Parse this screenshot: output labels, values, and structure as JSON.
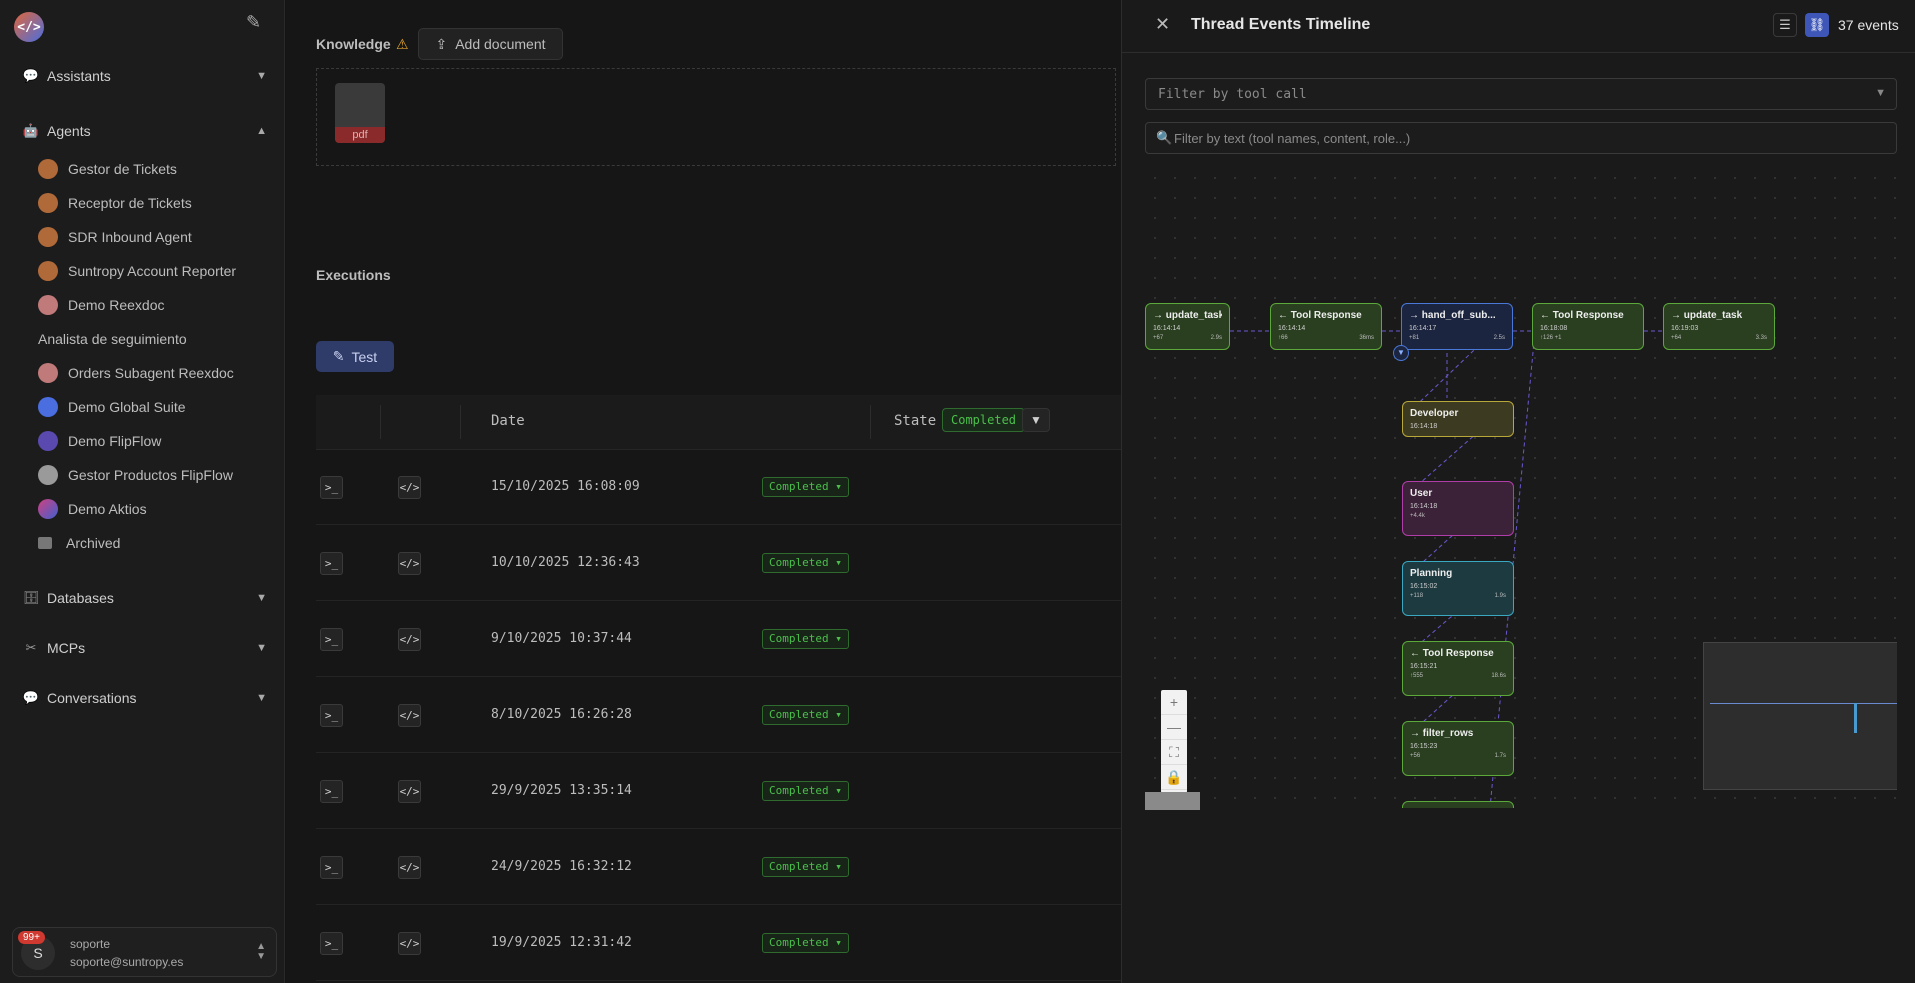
{
  "sidebar": {
    "logo_text": "</>",
    "sections": {
      "assistants": "Assistants",
      "agents": "Agents",
      "databases": "Databases",
      "mcps": "MCPs",
      "conversations": "Conversations"
    },
    "agents": [
      {
        "label": "Gestor de Tickets"
      },
      {
        "label": "Receptor de Tickets"
      },
      {
        "label": "SDR Inbound Agent"
      },
      {
        "label": "Suntropy Account Reporter"
      },
      {
        "label": "Demo Reexdoc"
      },
      {
        "label": "Analista de seguimiento"
      },
      {
        "label": "Orders Subagent Reexdoc"
      },
      {
        "label": "Demo Global Suite"
      },
      {
        "label": "Demo FlipFlow"
      },
      {
        "label": "Gestor Productos FlipFlow"
      },
      {
        "label": "Demo Aktios"
      },
      {
        "label": "Archived"
      }
    ],
    "user": {
      "badge": "99+",
      "initial": "S",
      "name": "soporte",
      "email": "soporte@suntropy.es"
    }
  },
  "main": {
    "knowledge_label": "Knowledge",
    "add_document_label": "Add document",
    "pdf_label": "pdf",
    "executions_label": "Executions",
    "test_label": "Test",
    "columns": {
      "date": "Date",
      "state": "State"
    },
    "state_filter": "Completed",
    "rows": [
      {
        "date": "15/10/2025 16:08:09",
        "status": "Completed"
      },
      {
        "date": "10/10/2025 12:36:43",
        "status": "Completed"
      },
      {
        "date": "9/10/2025 10:37:44",
        "status": "Completed"
      },
      {
        "date": "8/10/2025 16:26:28",
        "status": "Completed"
      },
      {
        "date": "29/9/2025 13:35:14",
        "status": "Completed"
      },
      {
        "date": "24/9/2025 16:32:12",
        "status": "Completed"
      },
      {
        "date": "19/9/2025 12:31:42",
        "status": "Completed"
      }
    ]
  },
  "panel": {
    "title": "Thread Events Timeline",
    "events_count": "37 events",
    "tool_filter_placeholder": "Filter by tool call",
    "text_filter_placeholder": "Filter by text (tool names, content, role...)",
    "nodes": [
      {
        "title": "→ update_task",
        "time": "16:14:14",
        "left": "+67",
        "right": "2.9s"
      },
      {
        "title": "← Tool Response",
        "time": "16:14:14",
        "left": "↑66",
        "right": "36ms"
      },
      {
        "title": "→ hand_off_sub...",
        "time": "16:14:17",
        "left": "+81",
        "right": "2.5s"
      },
      {
        "title": "← Tool Response",
        "time": "16:18:08",
        "left": "↑126 +1",
        "right": ""
      },
      {
        "title": "→ update_task",
        "time": "16:19:03",
        "left": "+64",
        "right": "3.3s"
      },
      {
        "title": "Developer",
        "time": "16:14:18",
        "left": "",
        "right": ""
      },
      {
        "title": "User",
        "time": "16:14:18",
        "left": "+4.4k",
        "right": ""
      },
      {
        "title": "Planning",
        "time": "16:15:02",
        "left": "+118",
        "right": "1.9s"
      },
      {
        "title": "← Tool Response",
        "time": "16:15:21",
        "left": "↑555",
        "right": "18.6s"
      },
      {
        "title": "→ filter_rows",
        "time": "16:15:23",
        "left": "+56",
        "right": "1.7s"
      }
    ]
  },
  "colors": {
    "accent_blue": "#3d56b8",
    "status_green": "#4cbf4c",
    "warning": "#e2a530"
  }
}
